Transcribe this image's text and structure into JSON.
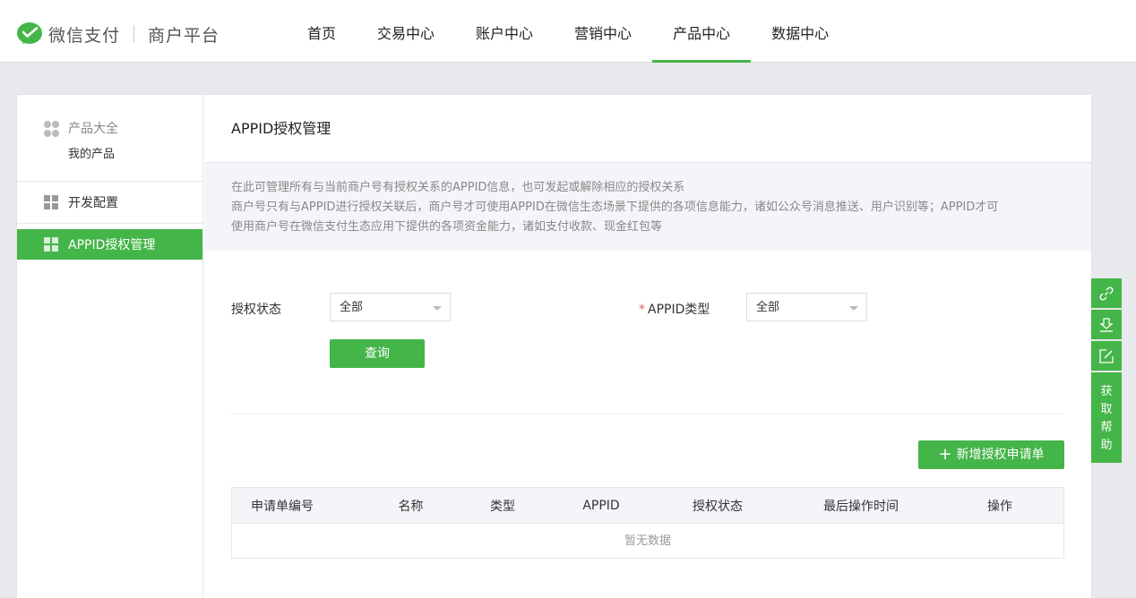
{
  "header": {
    "brand": "微信支付",
    "platform": "商户平台",
    "nav": [
      "首页",
      "交易中心",
      "账户中心",
      "营销中心",
      "产品中心",
      "数据中心"
    ],
    "active_nav": "产品中心"
  },
  "sidebar": {
    "group_title": "产品大全",
    "group_item": "我的产品",
    "items": [
      {
        "label": "开发配置"
      },
      {
        "label": "APPID授权管理"
      }
    ]
  },
  "page": {
    "title": "APPID授权管理",
    "notice_line1": "在此可管理所有与当前商户号有授权关系的APPID信息，也可发起或解除相应的授权关系",
    "notice_line2": "商户号只有与APPID进行授权关联后，商户号才可使用APPID在微信生态场景下提供的各项信息能力，诸如公众号消息推送、用户识别等；APPID才可",
    "notice_line3": "使用商户号在微信支付生态应用下提供的各项资金能力，诸如支付收款、现金红包等"
  },
  "filters": {
    "status_label": "授权状态",
    "status_value": "全部",
    "type_required_mark": "*",
    "type_label": "APPID类型",
    "type_value": "全部",
    "query_button": "查询"
  },
  "add_button": {
    "plus": "+",
    "label": "新增授权申请单"
  },
  "table": {
    "columns": [
      "申请单编号",
      "名称",
      "类型",
      "APPID",
      "授权状态",
      "最后操作时间",
      "操作"
    ],
    "empty_text": "暂无数据"
  },
  "tools": {
    "help_chars": [
      "获",
      "取",
      "帮",
      "助"
    ]
  },
  "colors": {
    "accent": "#44b549"
  }
}
